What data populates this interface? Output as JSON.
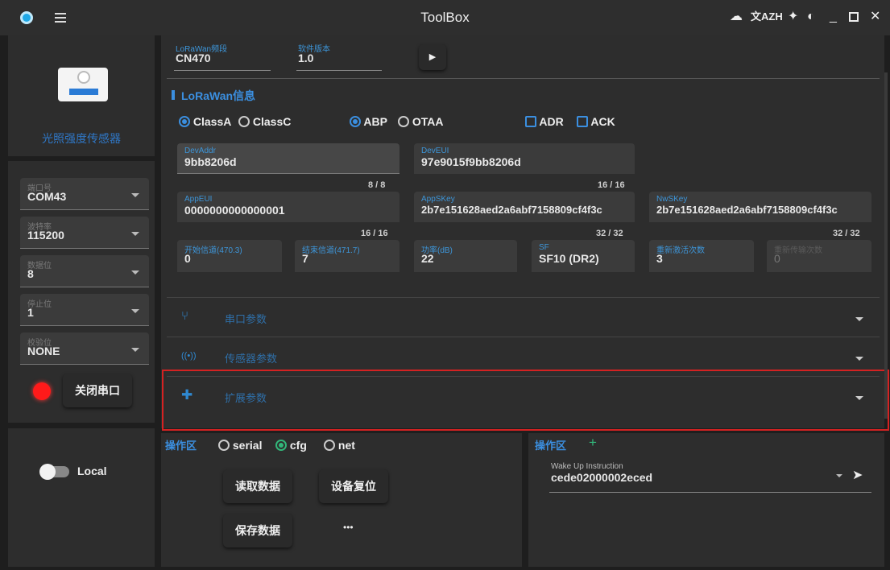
{
  "titlebar": {
    "title": "ToolBox",
    "translate_label": "文AZH"
  },
  "device": {
    "name": "光照强度传感器"
  },
  "serial": {
    "port": {
      "label": "端口号",
      "value": "COM43"
    },
    "baud": {
      "label": "波特率",
      "value": "115200"
    },
    "databits": {
      "label": "数据位",
      "value": "8"
    },
    "stopbits": {
      "label": "停止位",
      "value": "1"
    },
    "parity": {
      "label": "校验位",
      "value": "NONE"
    },
    "close_button": "关闭串口",
    "status_color": "#ff1a1a"
  },
  "local_toggle": {
    "label": "Local"
  },
  "top_fields": {
    "band": {
      "label": "LoRaWan频段",
      "value": "CN470"
    },
    "version": {
      "label": "软件版本",
      "value": "1.0"
    }
  },
  "lorawan": {
    "section_title": "LoRaWan信息",
    "class_options": [
      "ClassA",
      "ClassC"
    ],
    "class_selected": "ClassA",
    "join_options": [
      "ABP",
      "OTAA"
    ],
    "join_selected": "ABP",
    "checkboxes": [
      "ADR",
      "ACK"
    ],
    "devaddr": {
      "label": "DevAddr",
      "value": "9bb8206d",
      "counter": "8 / 8"
    },
    "deveui": {
      "label": "DevEUI",
      "value": "97e9015f9bb8206d",
      "counter": "16 / 16"
    },
    "appeui": {
      "label": "AppEUI",
      "value": "0000000000000001",
      "counter": "16 / 16"
    },
    "appskey": {
      "label": "AppSKey",
      "value": "2b7e151628aed2a6abf7158809cf4f3c",
      "counter": "32 / 32"
    },
    "nwskey": {
      "label": "NwSKey",
      "value": "2b7e151628aed2a6abf7158809cf4f3c",
      "counter": "32 / 32"
    },
    "start_channel": {
      "label": "开始信道(470.3)",
      "value": "0"
    },
    "end_channel": {
      "label": "结束信道(471.7)",
      "value": "7"
    },
    "power": {
      "label": "功率(dB)",
      "value": "22"
    },
    "sf": {
      "label": "SF",
      "value": "SF10 (DR2)"
    },
    "rejoin": {
      "label": "重新激活次数",
      "value": "3"
    },
    "retransmit": {
      "label": "重新传输次数",
      "value": "0"
    }
  },
  "sections": [
    {
      "label": "串口参数",
      "icon": "fork-icon"
    },
    {
      "label": "传感器参数",
      "icon": "broadcast-icon"
    },
    {
      "label": "扩展参数",
      "icon": "puzzle-icon"
    }
  ],
  "ops_left": {
    "title": "操作区",
    "modes": [
      "serial",
      "cfg",
      "net"
    ],
    "mode_selected": "cfg",
    "read_button": "读取数据",
    "reset_button": "设备复位",
    "save_button": "保存数据",
    "more_button": "•••"
  },
  "ops_right": {
    "title": "操作区",
    "add_label": "+",
    "wake_label": "Wake Up Instruction",
    "wake_value": "cede02000002eced"
  },
  "colors": {
    "accent": "#3b8fe0",
    "highlight_border": "#d42222",
    "cfg_green": "#32b77a"
  }
}
